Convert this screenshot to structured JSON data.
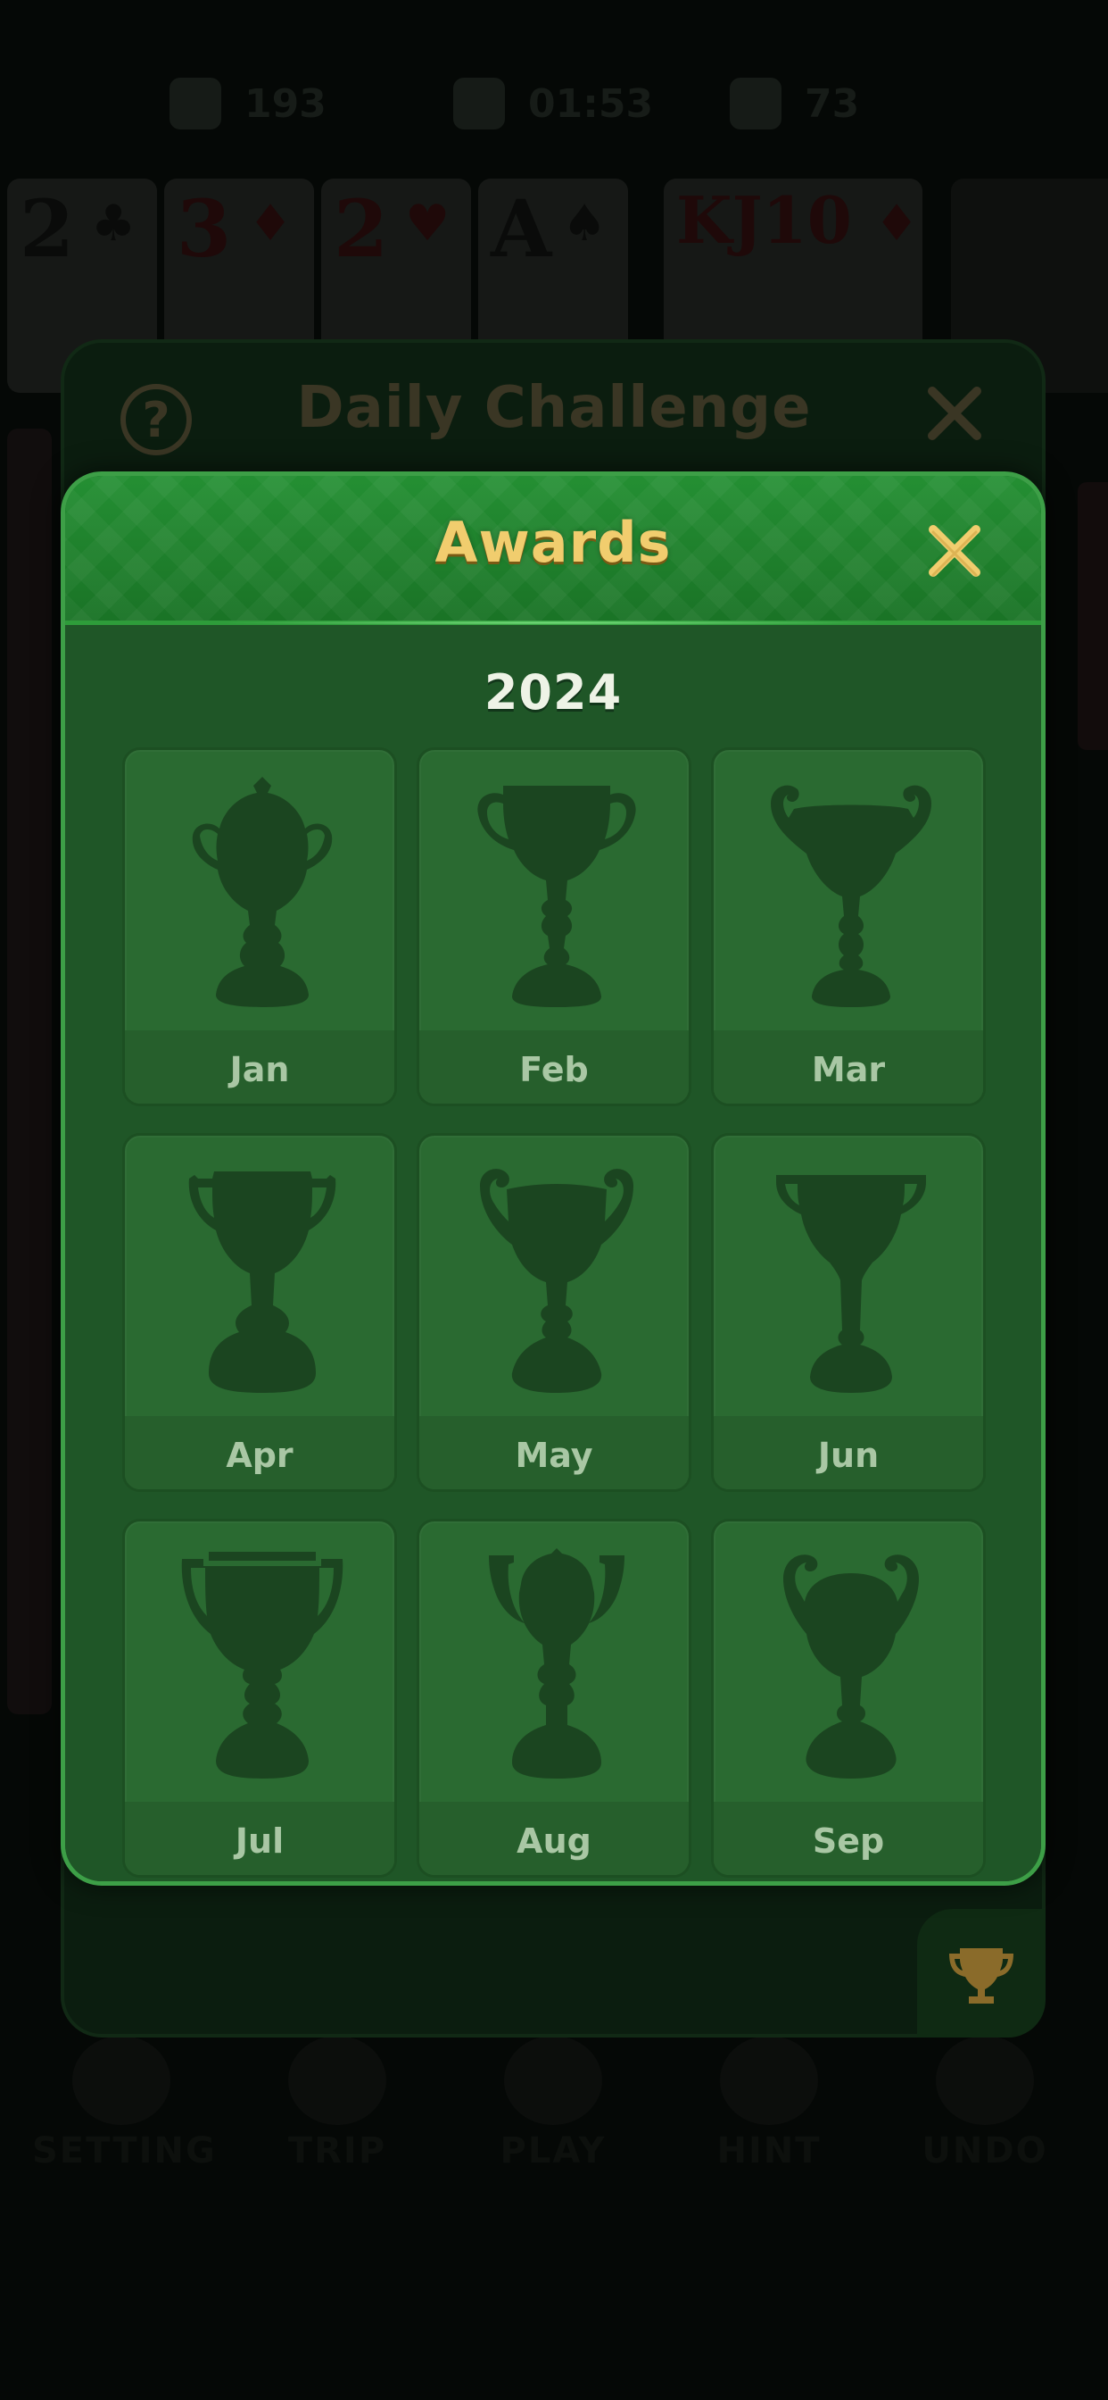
{
  "status_bar": {
    "score": "193",
    "time": "01:53",
    "moves": "73"
  },
  "background_cards": [
    {
      "rank": "2",
      "suit": "♣",
      "color": "black"
    },
    {
      "rank": "3",
      "suit": "♦",
      "color": "red"
    },
    {
      "rank": "2",
      "suit": "♥",
      "color": "red"
    },
    {
      "rank": "A",
      "suit": "♠",
      "color": "black"
    },
    {
      "rank": "KJ10",
      "suit": "♦",
      "color": "red"
    }
  ],
  "bottom_bar": {
    "setting": "SETTING",
    "trip": "TRIP",
    "play": "PLAY",
    "hint": "HINT",
    "undo": "UNDO"
  },
  "daily_challenge": {
    "title": "Daily Challenge",
    "help_symbol": "?"
  },
  "awards_modal": {
    "title": "Awards",
    "year": "2024",
    "months": [
      {
        "label": "Jan",
        "trophy": "trophy-icon",
        "earned": false
      },
      {
        "label": "Feb",
        "trophy": "trophy-icon",
        "earned": false
      },
      {
        "label": "Mar",
        "trophy": "trophy-icon",
        "earned": false
      },
      {
        "label": "Apr",
        "trophy": "trophy-icon",
        "earned": false
      },
      {
        "label": "May",
        "trophy": "trophy-icon",
        "earned": false
      },
      {
        "label": "Jun",
        "trophy": "trophy-icon",
        "earned": false
      },
      {
        "label": "Jul",
        "trophy": "trophy-icon",
        "earned": false
      },
      {
        "label": "Aug",
        "trophy": "trophy-icon",
        "earned": false
      },
      {
        "label": "Sep",
        "trophy": "trophy-icon",
        "earned": false
      }
    ]
  },
  "colors": {
    "modal_green": "#1f5627",
    "header_green": "#1f8a2f",
    "title_gold": "#f1cd6e",
    "trophy_silhouette": "#1b4520"
  }
}
